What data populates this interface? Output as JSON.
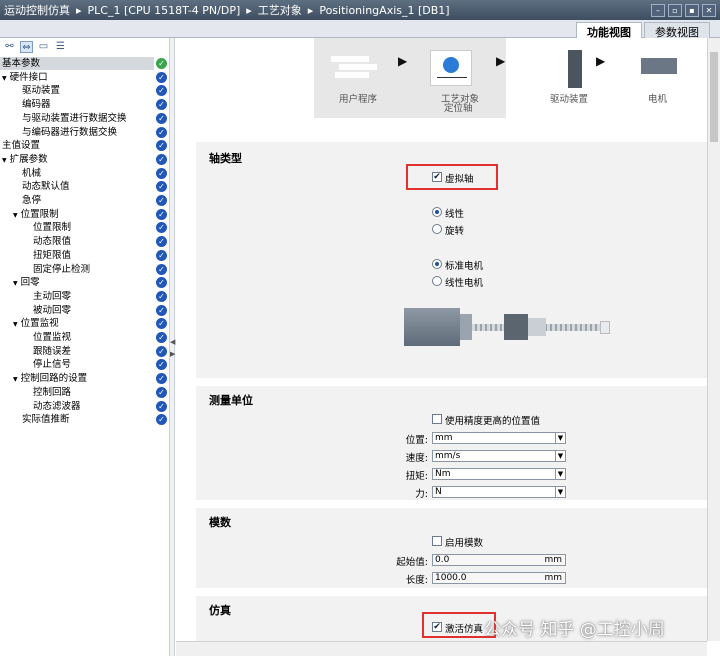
{
  "titlebar": {
    "parts": [
      "运动控制仿真",
      "PLC_1 [CPU 1518T-4 PN/DP]",
      "工艺对象",
      "PositioningAxis_1 [DB1]"
    ],
    "separator": "▸",
    "controls": [
      "–",
      "▫",
      "▪",
      "✕"
    ]
  },
  "tabs": [
    "功能视图",
    "参数视图"
  ],
  "toolbar": {
    "icons": [
      "tree-view-icon",
      "axis-view-icon",
      "folder-view-icon",
      "list-view-icon"
    ]
  },
  "nav": {
    "items": [
      {
        "label": "基本参数",
        "indent": 0,
        "expander": "",
        "status": "ok-green",
        "selected": true
      },
      {
        "label": "硬件接口",
        "indent": 0,
        "expander": "▼",
        "status": "ok"
      },
      {
        "label": "驱动装置",
        "indent": 1,
        "expander": "",
        "status": "ok"
      },
      {
        "label": "编码器",
        "indent": 1,
        "expander": "",
        "status": "ok"
      },
      {
        "label": "与驱动装置进行数据交换",
        "indent": 1,
        "expander": "",
        "status": "ok"
      },
      {
        "label": "与编码器进行数据交换",
        "indent": 1,
        "expander": "",
        "status": "ok"
      },
      {
        "label": "主值设置",
        "indent": 0,
        "expander": "",
        "status": "ok"
      },
      {
        "label": "扩展参数",
        "indent": 0,
        "expander": "▼",
        "status": "ok"
      },
      {
        "label": "机械",
        "indent": 1,
        "expander": "",
        "status": "ok"
      },
      {
        "label": "动态默认值",
        "indent": 1,
        "expander": "",
        "status": "ok"
      },
      {
        "label": "急停",
        "indent": 1,
        "expander": "",
        "status": "ok"
      },
      {
        "label": "位置限制",
        "indent": 1,
        "expander": "▼",
        "status": "ok"
      },
      {
        "label": "位置限制",
        "indent": 2,
        "expander": "",
        "status": "ok"
      },
      {
        "label": "动态限值",
        "indent": 2,
        "expander": "",
        "status": "ok"
      },
      {
        "label": "扭矩限值",
        "indent": 2,
        "expander": "",
        "status": "ok"
      },
      {
        "label": "固定停止检测",
        "indent": 2,
        "expander": "",
        "status": "ok"
      },
      {
        "label": "回零",
        "indent": 1,
        "expander": "▼",
        "status": "ok"
      },
      {
        "label": "主动回零",
        "indent": 2,
        "expander": "",
        "status": "ok"
      },
      {
        "label": "被动回零",
        "indent": 2,
        "expander": "",
        "status": "ok"
      },
      {
        "label": "位置监视",
        "indent": 1,
        "expander": "▼",
        "status": "ok"
      },
      {
        "label": "位置监视",
        "indent": 2,
        "expander": "",
        "status": "ok"
      },
      {
        "label": "跟随误差",
        "indent": 2,
        "expander": "",
        "status": "ok"
      },
      {
        "label": "停止信号",
        "indent": 2,
        "expander": "",
        "status": "ok"
      },
      {
        "label": "控制回路的设置",
        "indent": 1,
        "expander": "▼",
        "status": "ok"
      },
      {
        "label": "控制回路",
        "indent": 2,
        "expander": "",
        "status": "ok"
      },
      {
        "label": "动态滤波器",
        "indent": 2,
        "expander": "",
        "status": "ok"
      },
      {
        "label": "实际值推断",
        "indent": 1,
        "expander": "",
        "status": "ok"
      }
    ]
  },
  "diagram": {
    "labels": [
      "用户程序",
      "工艺对象",
      "定位轴",
      "驱动装置",
      "电机"
    ],
    "arrow": "▶"
  },
  "axis_type": {
    "title": "轴类型",
    "virtual_axis_label": "虚拟轴",
    "virtual_axis_checked": true,
    "motion_options": [
      "线性",
      "旋转"
    ],
    "motion_selected": "线性",
    "motor_options": [
      "标准电机",
      "线性电机"
    ],
    "motor_selected": "标准电机"
  },
  "measure_units": {
    "title": "测量单位",
    "high_precision_label": "使用精度更高的位置值",
    "high_precision_checked": false,
    "rows": [
      {
        "label": "位置:",
        "value": "mm"
      },
      {
        "label": "速度:",
        "value": "mm/s"
      },
      {
        "label": "扭矩:",
        "value": "Nm"
      },
      {
        "label": "力:",
        "value": "N"
      }
    ]
  },
  "modulo": {
    "title": "模数",
    "enable_label": "启用模数",
    "enable_checked": false,
    "rows": [
      {
        "label": "起始值:",
        "value": "0.0",
        "unit": "mm"
      },
      {
        "label": "长度:",
        "value": "1000.0",
        "unit": "mm"
      }
    ]
  },
  "simulation": {
    "title": "仿真",
    "activate_label": "激活仿真",
    "activate_checked": true
  },
  "watermark": "公众号 知乎 @工控小周",
  "colors": {
    "titlebar": "#4a5a6e",
    "check_blue": "#2157b8",
    "check_green": "#3aa54b",
    "highlight_red": "#e03030",
    "section_bg": "#f2f2f2"
  }
}
